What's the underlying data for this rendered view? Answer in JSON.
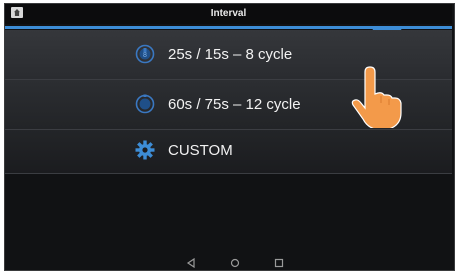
{
  "header": {
    "title": "Interval"
  },
  "options": [
    {
      "label": "25s / 15s – 8 cycle",
      "icon": "stopwatch-icon"
    },
    {
      "label": "60s / 75s – 12 cycle",
      "icon": "stopwatch-icon"
    },
    {
      "label": "CUSTOM",
      "icon": "gear-icon"
    }
  ],
  "nav": {
    "back": "back-icon",
    "home": "home-nav-icon",
    "recents": "recents-icon"
  },
  "colors": {
    "accent": "#3d8dd6",
    "hand": "#f39a4a"
  }
}
